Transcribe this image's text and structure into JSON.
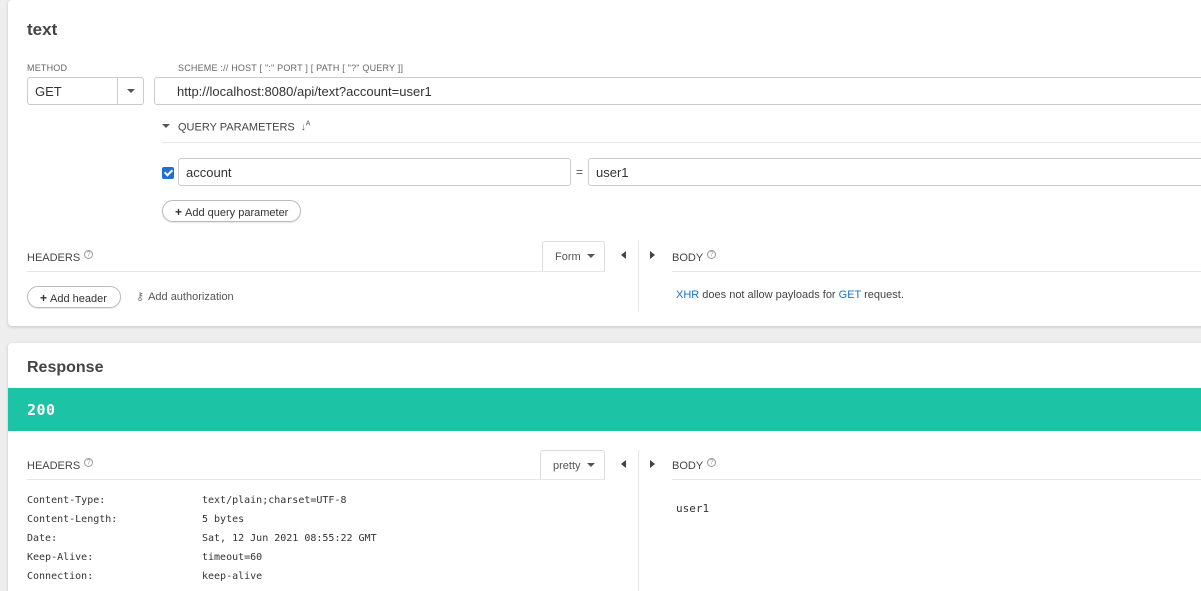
{
  "request": {
    "title": "text",
    "method_label": "METHOD",
    "method_value": "GET",
    "url_label": "SCHEME :// HOST [ \":\" PORT ] [ PATH [ \"?\" QUERY ]]",
    "url_value": "http://localhost:8080/api/text?account=user1",
    "query_params_label": "QUERY PARAMETERS",
    "params": [
      {
        "enabled": true,
        "key": "account",
        "value": "user1"
      }
    ],
    "equals_sign": "=",
    "add_query_param_label": "Add query parameter",
    "headers_label": "HEADERS",
    "headers_mode": "Form",
    "add_header_label": "Add header",
    "add_authorization_label": "Add authorization",
    "body_label": "BODY",
    "body_info": {
      "xhr": "XHR",
      "middle": " does not allow payloads for ",
      "method": "GET",
      "end": " request."
    }
  },
  "response": {
    "title": "Response",
    "status_code": "200",
    "status_color": "#1cc4a5",
    "headers_label": "HEADERS",
    "headers_mode": "pretty",
    "body_label": "BODY",
    "body_content": "user1",
    "headers": [
      {
        "name": "Content-Type:",
        "value": "text/plain;charset=UTF-8"
      },
      {
        "name": "Content-Length:",
        "value": "5 bytes"
      },
      {
        "name": "Date:",
        "value": "Sat, 12 Jun 2021 08:55:22 GMT"
      },
      {
        "name": "Keep-Alive:",
        "value": "timeout=60"
      },
      {
        "name": "Connection:",
        "value": "keep-alive"
      }
    ]
  },
  "icons": {
    "help": "?",
    "plus": "+",
    "key": "key-icon",
    "sort": "sort-alpha-icon"
  }
}
